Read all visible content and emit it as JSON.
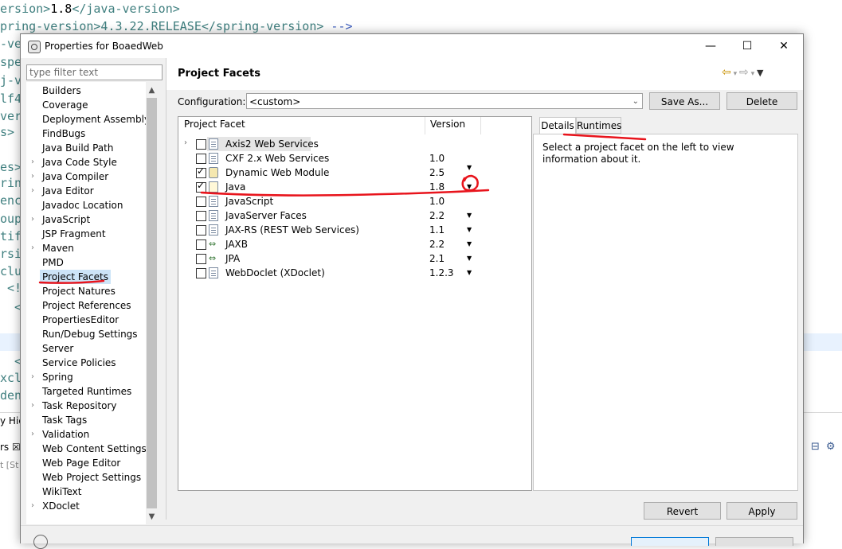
{
  "editor": {
    "line1": {
      "open": "ersion>",
      "value": "1.8",
      "close": "</java-version>"
    },
    "line2": {
      "text": "pring-version>4.3.22.RELEASE</spring-version>",
      "comment": " -->"
    },
    "left_fragments": [
      "-ve",
      "spe",
      "j-v",
      "lf4",
      "ver",
      "s>",
      "",
      "es>",
      "rin",
      "enc",
      "oup",
      "tif",
      "rsi",
      "clu",
      " <!",
      "  <e",
      "",
      "",
      "  <",
      "xcl",
      "den"
    ],
    "bottom_tab1": "y Hie",
    "bottom_tab2": "rs ☒",
    "bottom_tab3": "t [St"
  },
  "dialog": {
    "title": "Properties for BoaedWeb",
    "window_controls": {
      "minimize": "—",
      "maximize": "☐",
      "close": "✕"
    },
    "filter_placeholder": "type filter text",
    "tree": [
      {
        "label": "Builders",
        "expandable": false
      },
      {
        "label": "Coverage",
        "expandable": false
      },
      {
        "label": "Deployment Assembly",
        "expandable": false
      },
      {
        "label": "FindBugs",
        "expandable": false
      },
      {
        "label": "Java Build Path",
        "expandable": false
      },
      {
        "label": "Java Code Style",
        "expandable": true
      },
      {
        "label": "Java Compiler",
        "expandable": true
      },
      {
        "label": "Java Editor",
        "expandable": true
      },
      {
        "label": "Javadoc Location",
        "expandable": false
      },
      {
        "label": "JavaScript",
        "expandable": true
      },
      {
        "label": "JSP Fragment",
        "expandable": false
      },
      {
        "label": "Maven",
        "expandable": true
      },
      {
        "label": "PMD",
        "expandable": false
      },
      {
        "label": "Project Facets",
        "expandable": false,
        "selected": true
      },
      {
        "label": "Project Natures",
        "expandable": false
      },
      {
        "label": "Project References",
        "expandable": false
      },
      {
        "label": "PropertiesEditor",
        "expandable": false
      },
      {
        "label": "Run/Debug Settings",
        "expandable": false
      },
      {
        "label": "Server",
        "expandable": false
      },
      {
        "label": "Service Policies",
        "expandable": false
      },
      {
        "label": "Spring",
        "expandable": true
      },
      {
        "label": "Targeted Runtimes",
        "expandable": false
      },
      {
        "label": "Task Repository",
        "expandable": true
      },
      {
        "label": "Task Tags",
        "expandable": false
      },
      {
        "label": "Validation",
        "expandable": true
      },
      {
        "label": "Web Content Settings",
        "expandable": false
      },
      {
        "label": "Web Page Editor",
        "expandable": false
      },
      {
        "label": "Web Project Settings",
        "expandable": false
      },
      {
        "label": "WikiText",
        "expandable": false
      },
      {
        "label": "XDoclet",
        "expandable": true
      }
    ],
    "page_title": "Project Facets",
    "configuration_label": "Configuration:",
    "configuration_value": "<custom>",
    "save_as_label": "Save As...",
    "delete_label": "Delete",
    "table_headers": {
      "facet": "Project Facet",
      "version": "Version"
    },
    "facets": [
      {
        "name": "Axis2 Web Services",
        "version": "",
        "checked": false,
        "icon": "doc",
        "expander": true,
        "dropdown": false,
        "selected": true
      },
      {
        "name": "CXF 2.x Web Services",
        "version": "1.0",
        "checked": false,
        "icon": "doc",
        "expander": false,
        "dropdown": false
      },
      {
        "name": "Dynamic Web Module",
        "version": "2.5",
        "checked": true,
        "icon": "globe",
        "expander": false,
        "dropdown": true
      },
      {
        "name": "Java",
        "version": "1.8",
        "checked": true,
        "icon": "java",
        "expander": false,
        "dropdown": true
      },
      {
        "name": "JavaScript",
        "version": "1.0",
        "checked": false,
        "icon": "doc",
        "expander": false,
        "dropdown": false
      },
      {
        "name": "JavaServer Faces",
        "version": "2.2",
        "checked": false,
        "icon": "doc",
        "expander": false,
        "dropdown": true
      },
      {
        "name": "JAX-RS (REST Web Services)",
        "version": "1.1",
        "checked": false,
        "icon": "doc",
        "expander": false,
        "dropdown": true
      },
      {
        "name": "JAXB",
        "version": "2.2",
        "checked": false,
        "icon": "arrows",
        "expander": false,
        "dropdown": true
      },
      {
        "name": "JPA",
        "version": "2.1",
        "checked": false,
        "icon": "arrows",
        "expander": false,
        "dropdown": true
      },
      {
        "name": "WebDoclet (XDoclet)",
        "version": "1.2.3",
        "checked": false,
        "icon": "doc",
        "expander": false,
        "dropdown": true
      }
    ],
    "tabs": {
      "details": "Details",
      "runtimes": "Runtimes"
    },
    "details_text": "Select a project facet on the left to view information about it.",
    "revert_label": "Revert",
    "apply_label": "Apply",
    "annotation_color": "#e8141c"
  }
}
